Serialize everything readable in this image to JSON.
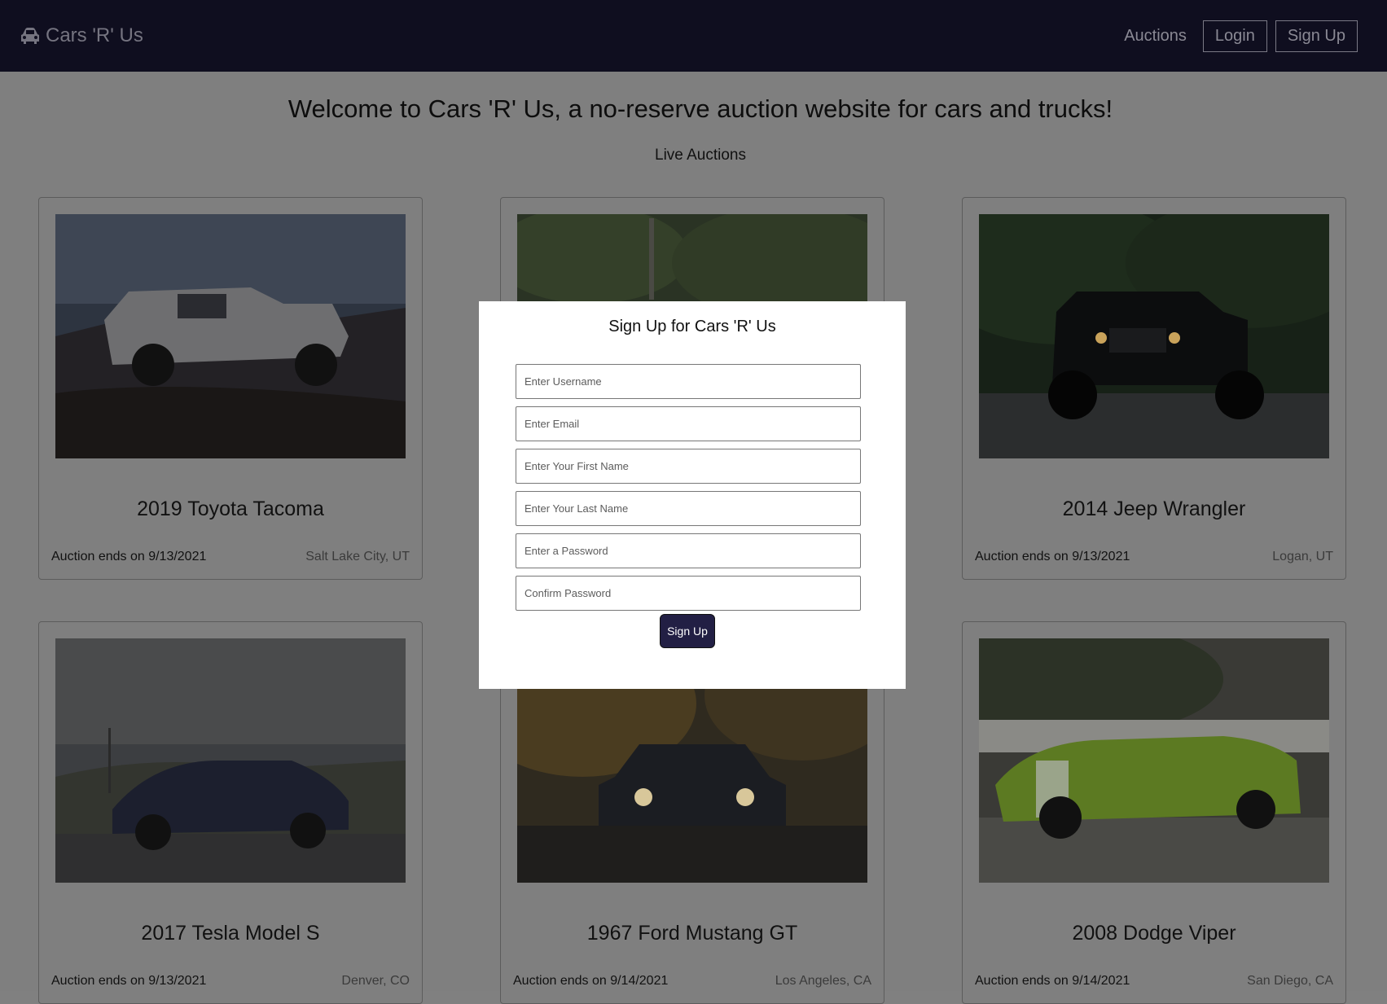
{
  "nav": {
    "brand": "Cars 'R' Us",
    "auctions_link": "Auctions",
    "login_button": "Login",
    "signup_button": "Sign Up"
  },
  "main": {
    "welcome": "Welcome to Cars 'R' Us, a no-reserve auction website for cars and trucks!",
    "subheading": "Live Auctions"
  },
  "cards": [
    {
      "title": "2019 Toyota Tacoma",
      "ends": "Auction ends on 9/13/2021",
      "location": "Salt Lake City, UT"
    },
    {
      "title": "",
      "ends": "",
      "location": ""
    },
    {
      "title": "2014 Jeep Wrangler",
      "ends": "Auction ends on 9/13/2021",
      "location": "Logan, UT"
    },
    {
      "title": "2017 Tesla Model S",
      "ends": "Auction ends on 9/13/2021",
      "location": "Denver, CO"
    },
    {
      "title": "1967 Ford Mustang GT",
      "ends": "Auction ends on 9/14/2021",
      "location": "Los Angeles, CA"
    },
    {
      "title": "2008 Dodge Viper",
      "ends": "Auction ends on 9/14/2021",
      "location": "San Diego, CA"
    }
  ],
  "modal": {
    "title": "Sign Up for Cars 'R' Us",
    "username_placeholder": "Enter Username",
    "email_placeholder": "Enter Email",
    "first_name_placeholder": "Enter Your First Name",
    "last_name_placeholder": "Enter Your Last Name",
    "password_placeholder": "Enter a Password",
    "confirm_password_placeholder": "Confirm Password",
    "submit_label": "Sign Up"
  },
  "colors": {
    "navbar_bg": "#0f0e1f",
    "overlay_bg": "#7f7f7f",
    "modal_bg": "#ffffff",
    "submit_bg": "#221f44"
  }
}
